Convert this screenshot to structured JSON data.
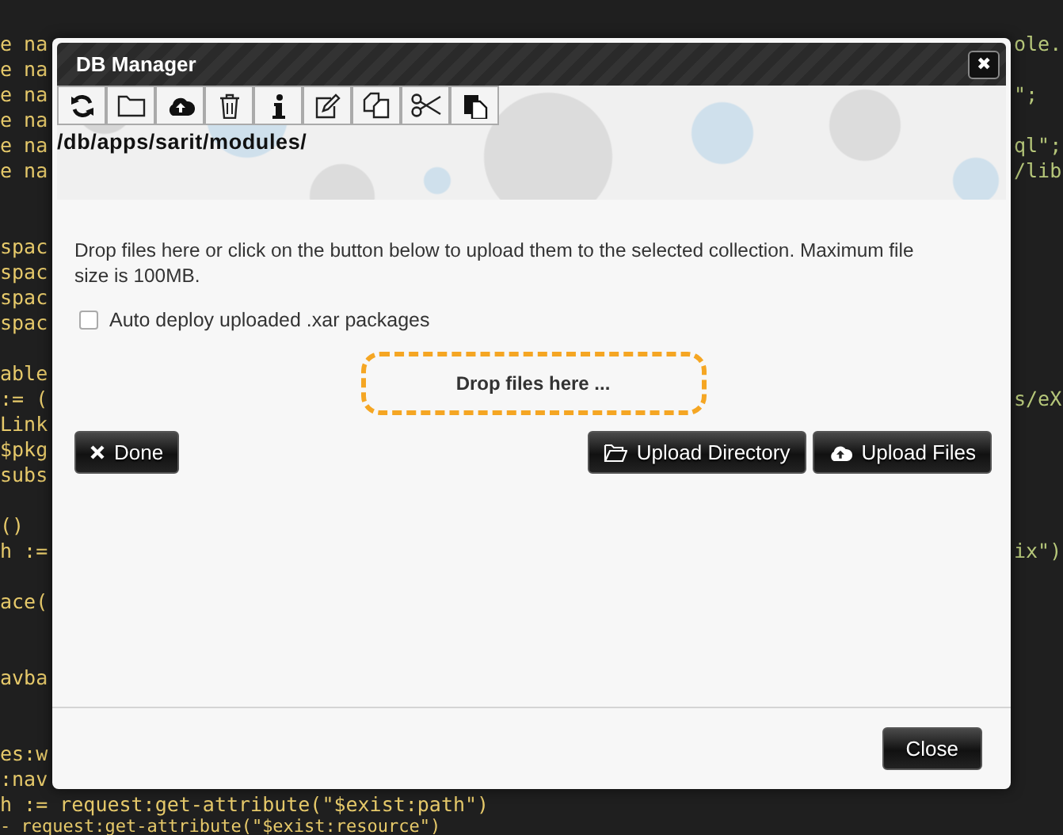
{
  "editor": {
    "left_blocks": [
      [
        "e na",
        "e na",
        "e na",
        "e na",
        "e na",
        "e na"
      ],
      [
        "spac",
        "spac",
        "spac",
        "spac"
      ],
      [
        "able",
        ":= (",
        "Link",
        "$pkg",
        "subs"
      ],
      [
        "()",
        "h :="
      ],
      [
        "ace("
      ],
      [
        "avba"
      ],
      [
        "es:w",
        ":nav",
        "h := request:get-attribute(\"$exist:path\")",
        "- request:get-attribute(\"$exist:resource\")"
      ]
    ],
    "right_blocks": [
      [
        "ole."
      ],
      [
        "\";"
      ],
      [
        "ql\";",
        "/lib"
      ],
      [
        "s/eX"
      ],
      [
        "ix\")"
      ]
    ]
  },
  "dialog": {
    "title": "DB Manager",
    "close_glyph": "✖",
    "toolbar": [
      {
        "kind": "refresh"
      },
      {
        "kind": "folder"
      },
      {
        "kind": "upload"
      },
      {
        "kind": "trash"
      },
      {
        "kind": "info"
      },
      {
        "kind": "edit"
      },
      {
        "kind": "copy"
      },
      {
        "kind": "cut"
      },
      {
        "kind": "paste"
      }
    ],
    "path": "/db/apps/sarit/modules/",
    "description": "Drop files here or click on the button below to upload them to the selected collection. Maximum file size is 100MB.",
    "auto_deploy": {
      "label": "Auto deploy uploaded .xar packages",
      "checked": false
    },
    "drop_zone": "Drop files here ...",
    "buttons": [
      {
        "kind": "done",
        "label": "Done"
      },
      {
        "kind": "upload-directory",
        "label": "Upload Directory"
      },
      {
        "kind": "upload-files",
        "label": "Upload Files"
      }
    ],
    "footer_button": "Close"
  }
}
